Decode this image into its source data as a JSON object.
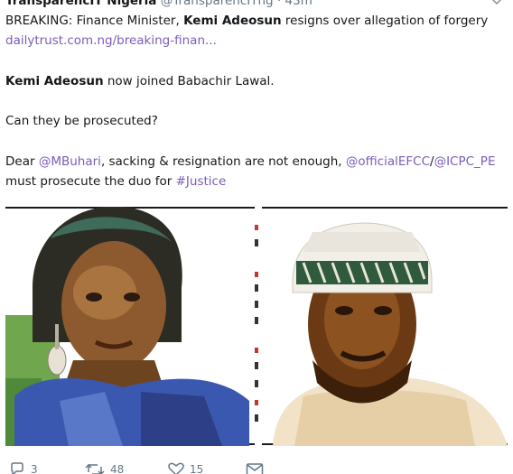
{
  "tweet": {
    "author_name": "TransparencIT Nigeria",
    "author_handle": "@TransparencITng",
    "separator": "·",
    "timestamp": "43m",
    "breaking_prefix": "BREAKING: Finance Minister, ",
    "breaking_name": "Kemi Adeosun",
    "breaking_suffix": " resigns over allegation of forgery",
    "link_text": "dailytrust.com.ng/breaking-finan...",
    "joined_name": "Kemi Adeosun",
    "joined_suffix": " now joined Babachir Lawal.",
    "question": "Can they be prosecuted?",
    "dear_prefix": "Dear ",
    "mention_buhari": "@MBuhari",
    "dear_middle": ", sacking & resignation are not enough, ",
    "mention_efcc": "@officialEFCC",
    "slash": "/",
    "mention_icpc": "@ICPC_PE",
    "prosecute_prefix": "must prosecute the duo for ",
    "hashtag": "#Justice"
  },
  "actions": {
    "reply_count": "3",
    "retweet_count": "48",
    "like_count": "15"
  },
  "icons": {
    "caret": "chevron-down-icon",
    "reply": "reply-icon",
    "retweet": "retweet-icon",
    "like": "heart-icon",
    "message": "direct-message-icon"
  },
  "colors": {
    "link": "#7b5cb8",
    "muted": "#657786",
    "text": "#14171a"
  }
}
